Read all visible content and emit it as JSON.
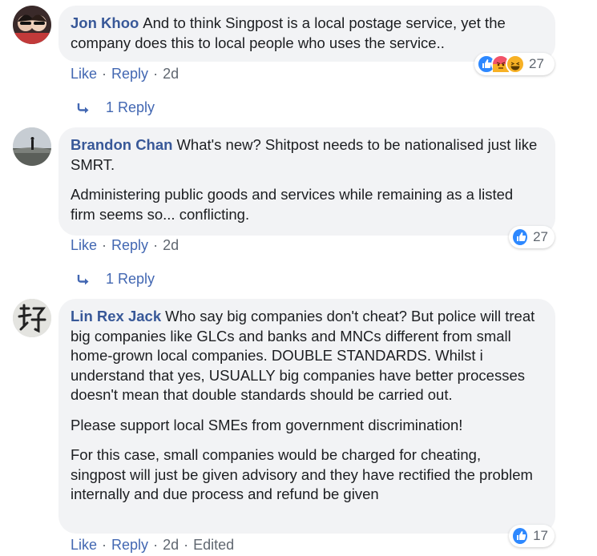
{
  "comments": [
    {
      "author": "Jon Khoo",
      "paragraphs": [
        "And to think Singpost is a local postage service, yet the company does this to local people who uses the service.."
      ],
      "actions": {
        "like": "Like",
        "reply": "Reply",
        "time": "2d"
      },
      "reaction_icons": [
        "like-icon",
        "angry-icon",
        "haha-icon"
      ],
      "reaction_count": "27",
      "reply_link": "1 Reply"
    },
    {
      "author": "Brandon Chan",
      "paragraphs": [
        "What's new? Shitpost needs to be nationalised just like SMRT.",
        "Administering public goods and services while remaining as a listed firm seems so... conflicting."
      ],
      "actions": {
        "like": "Like",
        "reply": "Reply",
        "time": "2d"
      },
      "reaction_icons": [
        "like-icon"
      ],
      "reaction_count": "27",
      "reply_link": "1 Reply"
    },
    {
      "author": "Lin Rex Jack",
      "paragraphs": [
        "Who say big companies don't cheat? But police will treat big companies like GLCs and banks and MNCs different from small home-grown local companies. DOUBLE STANDARDS. Whilst i understand that yes, USUALLY big companies have better processes doesn't mean that double standards should be carried out.",
        "Please support local SMEs from government discrimination!",
        "For this case, small companies would be charged for cheating, singpost will just be given advisory and they have rectified the problem internally and due process and refund be given"
      ],
      "actions": {
        "like": "Like",
        "reply": "Reply",
        "time": "2d",
        "edited": "Edited"
      },
      "reaction_icons": [
        "like-icon"
      ],
      "reaction_count": "17"
    }
  ],
  "colors": {
    "link": "#4267b2",
    "author": "#385898",
    "bubble": "#f2f3f5",
    "like": "#2d88ff",
    "angry": "#f25268",
    "haha": "#f7b125"
  }
}
